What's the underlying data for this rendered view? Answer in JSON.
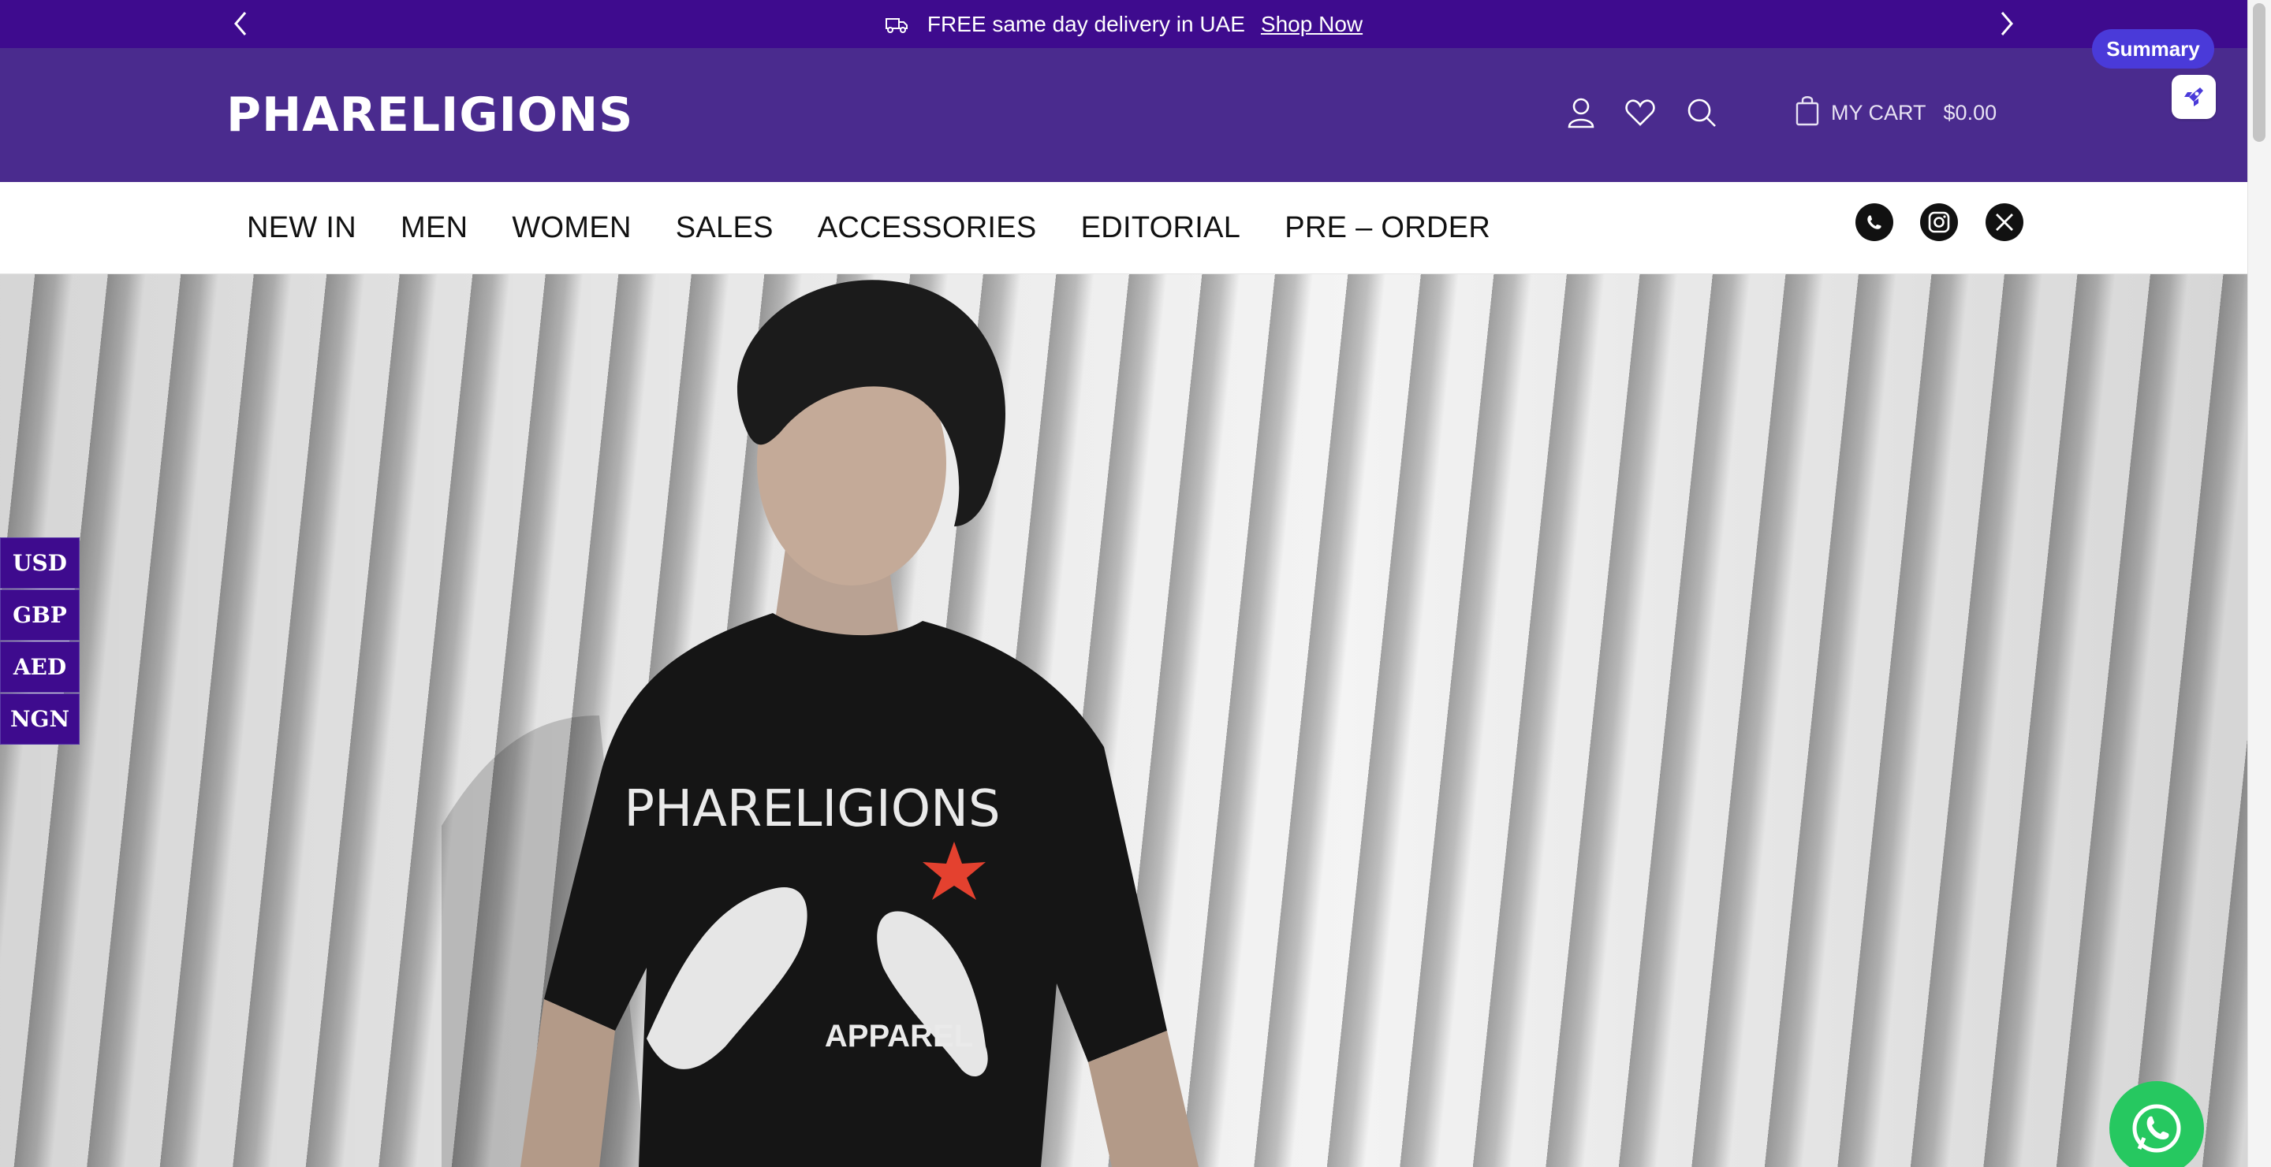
{
  "announcement": {
    "text": "FREE same day delivery in UAE",
    "link": "Shop Now",
    "icons": {
      "prev": "chevron-left-icon",
      "next": "chevron-right-icon",
      "truck": "truck-icon"
    }
  },
  "header": {
    "logo": "PHARELIGIONS",
    "icons": [
      "user-icon",
      "heart-icon",
      "search-icon",
      "shopping-bag-icon"
    ],
    "cart_label": "MY CART",
    "cart_amount": "$0.00"
  },
  "nav": {
    "items": [
      "NEW IN",
      "MEN",
      "WOMEN",
      "SALES",
      "ACCESSORIES",
      "EDITORIAL",
      "PRE – ORDER"
    ],
    "social": [
      "whatsapp-icon",
      "instagram-icon",
      "x-icon"
    ]
  },
  "hero": {
    "shirt_print_top": "PHARELIGIONS",
    "shirt_print_bottom": "APPAREL"
  },
  "currency": {
    "options": [
      "USD",
      "GBP",
      "AED",
      "NGN"
    ]
  },
  "widget": {
    "summary_label": "Summary"
  },
  "colors": {
    "announcement_bg": "#3e0b8e",
    "header_bg": "#4a2b8e",
    "summary_bg": "#4a3ad9",
    "whatsapp": "#26c860"
  }
}
